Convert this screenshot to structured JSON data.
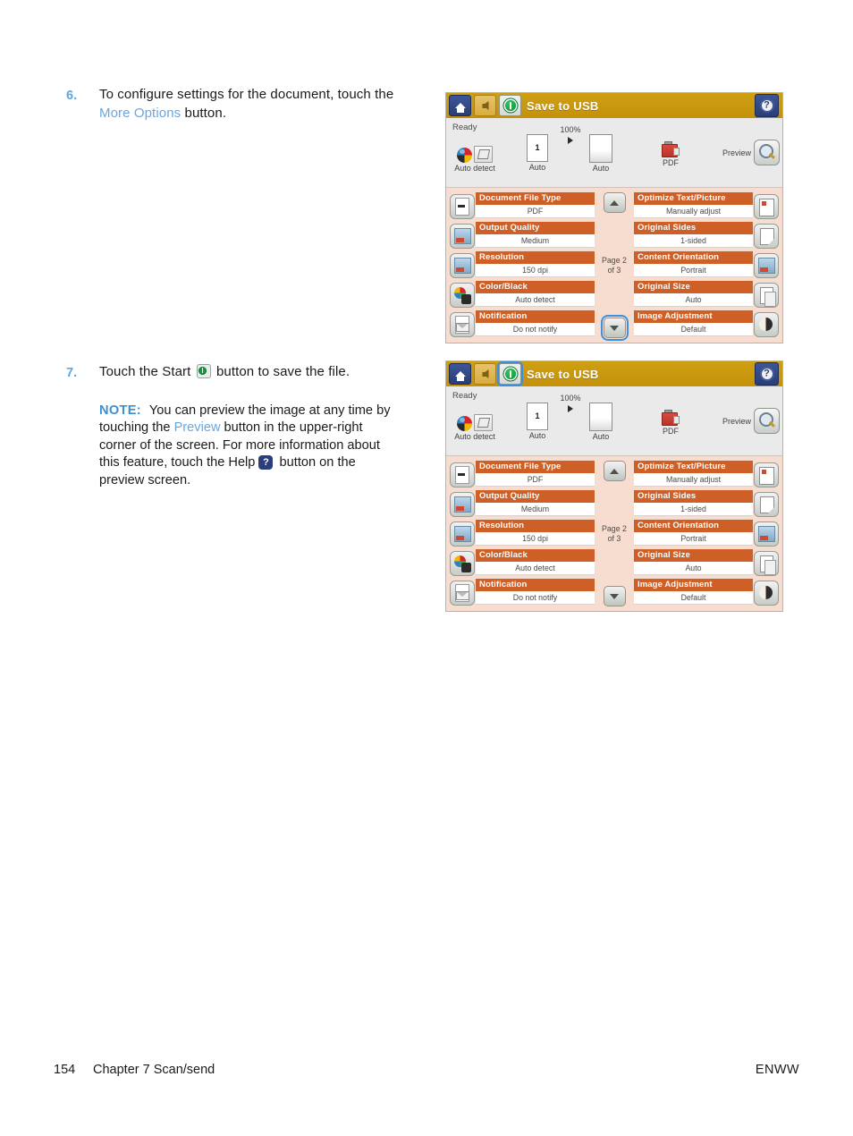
{
  "page": {
    "footer": {
      "page_number": "154",
      "chapter": "Chapter 7   Scan/send",
      "right": "ENWW"
    }
  },
  "steps": [
    {
      "number": "6.",
      "text_before": "To configure settings for the document, touch the ",
      "link": "More Options",
      "text_after": " button."
    },
    {
      "number": "7.",
      "text_before": "Touch the Start ",
      "icon": "start-icon",
      "text_after": " button to save the file."
    }
  ],
  "note": {
    "label": "NOTE:",
    "part1": "You can preview the image at any time by touching the ",
    "link": "Preview",
    "part2": " button in the upper-right corner of the screen. For more information about this feature, touch the Help ",
    "part3": " button on the preview screen."
  },
  "screenshots": [
    {
      "id": "screenshot-step-6",
      "header": {
        "home_icon": "home-icon",
        "back_icon": "back-arrow-icon",
        "start_icon": "start-icon",
        "title": "Save to USB",
        "help_icon": "help-icon",
        "start_highlighted": false
      },
      "status": {
        "ready": "Ready",
        "color_mode": "Auto detect",
        "copies": "1",
        "copies_caption": "Auto",
        "zoom": "100%",
        "output_caption": "Auto",
        "file_type": "PDF",
        "preview_label": "Preview"
      },
      "pagination": {
        "up_icon": "chevron-up-icon",
        "down_icon": "chevron-down-icon",
        "page_line1": "Page 2",
        "page_line2": "of 3",
        "down_highlighted": true
      },
      "left_settings": [
        {
          "label": "Document File Type",
          "value": "PDF",
          "icon": "document-file-icon"
        },
        {
          "label": "Output Quality",
          "value": "Medium",
          "icon": "output-quality-icon"
        },
        {
          "label": "Resolution",
          "value": "150 dpi",
          "icon": "resolution-icon"
        },
        {
          "label": "Color/Black",
          "value": "Auto detect",
          "icon": "color-black-icon"
        },
        {
          "label": "Notification",
          "value": "Do not notify",
          "icon": "notification-icon"
        }
      ],
      "right_settings": [
        {
          "label": "Optimize Text/Picture",
          "value": "Manually adjust",
          "icon": "optimize-text-picture-icon"
        },
        {
          "label": "Original Sides",
          "value": "1-sided",
          "icon": "original-sides-icon"
        },
        {
          "label": "Content Orientation",
          "value": "Portrait",
          "icon": "content-orientation-icon"
        },
        {
          "label": "Original Size",
          "value": "Auto",
          "icon": "original-size-icon"
        },
        {
          "label": "Image Adjustment",
          "value": "Default",
          "icon": "image-adjustment-icon"
        }
      ]
    },
    {
      "id": "screenshot-step-7",
      "header": {
        "home_icon": "home-icon",
        "back_icon": "back-arrow-icon",
        "start_icon": "start-icon",
        "title": "Save to USB",
        "help_icon": "help-icon",
        "start_highlighted": true
      },
      "status": {
        "ready": "Ready",
        "color_mode": "Auto detect",
        "copies": "1",
        "copies_caption": "Auto",
        "zoom": "100%",
        "output_caption": "Auto",
        "file_type": "PDF",
        "preview_label": "Preview"
      },
      "pagination": {
        "up_icon": "chevron-up-icon",
        "down_icon": "chevron-down-icon",
        "page_line1": "Page 2",
        "page_line2": "of 3",
        "down_highlighted": false
      },
      "left_settings": [
        {
          "label": "Document File Type",
          "value": "PDF",
          "icon": "document-file-icon"
        },
        {
          "label": "Output Quality",
          "value": "Medium",
          "icon": "output-quality-icon"
        },
        {
          "label": "Resolution",
          "value": "150 dpi",
          "icon": "resolution-icon"
        },
        {
          "label": "Color/Black",
          "value": "Auto detect",
          "icon": "color-black-icon"
        },
        {
          "label": "Notification",
          "value": "Do not notify",
          "icon": "notification-icon"
        }
      ],
      "right_settings": [
        {
          "label": "Optimize Text/Picture",
          "value": "Manually adjust",
          "icon": "optimize-text-picture-icon"
        },
        {
          "label": "Original Sides",
          "value": "1-sided",
          "icon": "original-sides-icon"
        },
        {
          "label": "Content Orientation",
          "value": "Portrait",
          "icon": "content-orientation-icon"
        },
        {
          "label": "Original Size",
          "value": "Auto",
          "icon": "original-size-icon"
        },
        {
          "label": "Image Adjustment",
          "value": "Default",
          "icon": "image-adjustment-icon"
        }
      ]
    }
  ],
  "colors": {
    "header_gold": "#c8960a",
    "setting_orange": "#cd5f27",
    "panel_peach": "#f6ddcf",
    "link_blue": "#6aa6dd",
    "note_blue": "#3d8fd4",
    "step_num_blue": "#5fa6dd",
    "start_green": "#129c3e",
    "highlight_blue": "#3e8fdc"
  }
}
